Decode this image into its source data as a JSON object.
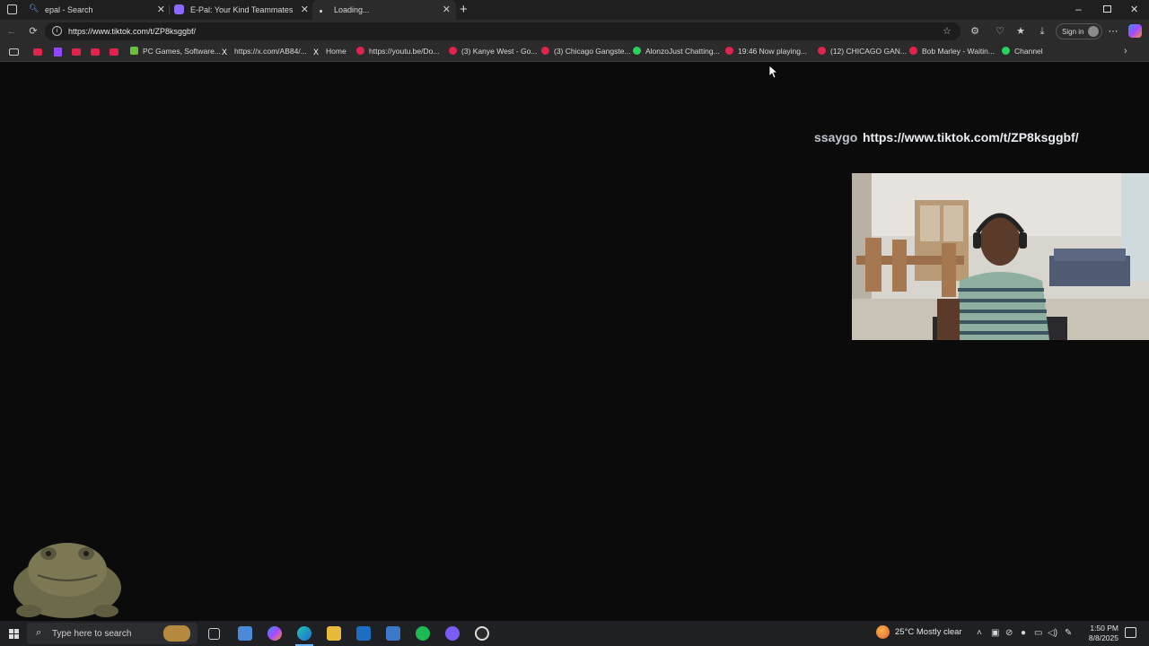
{
  "browser": {
    "tabs": [
      {
        "title": "epal - Search",
        "active": false
      },
      {
        "title": "E-Pal: Your Kind Teammates",
        "active": false
      },
      {
        "title": "Loading...",
        "active": true
      }
    ],
    "url": "https://www.tiktok.com/t/ZP8ksggbf/",
    "signin_label": "Sign in"
  },
  "bookmarks": [
    {
      "label": "PC Games, Software...",
      "icon": "pc-games-icon"
    },
    {
      "label": "https://x.com/AB84/...",
      "icon": "x-icon"
    },
    {
      "label": "Home",
      "icon": "x-icon"
    },
    {
      "label": "https://youtu.be/Do...",
      "icon": "youtube-icon"
    },
    {
      "label": "(3) Kanye West - Go...",
      "icon": "youtube-icon"
    },
    {
      "label": "(3) Chicago Gangste...",
      "icon": "youtube-icon"
    },
    {
      "label": "AlonzoJust Chatting...",
      "icon": "kick-icon"
    },
    {
      "label": "19:46 Now playing...",
      "icon": "youtube-icon"
    },
    {
      "label": "(12) CHICAGO GAN...",
      "icon": "youtube-icon"
    },
    {
      "label": "Bob Marley - Waitin...",
      "icon": "youtube-icon"
    },
    {
      "label": "Channel",
      "icon": "kick-icon"
    }
  ],
  "overlay": {
    "name": "ssaygo",
    "link": "https://www.tiktok.com/t/ZP8ksggbf/"
  },
  "taskbar": {
    "search_placeholder": "Type here to search",
    "weather": "25°C  Mostly clear",
    "time": "1:50 PM",
    "date": "8/8/2025"
  }
}
